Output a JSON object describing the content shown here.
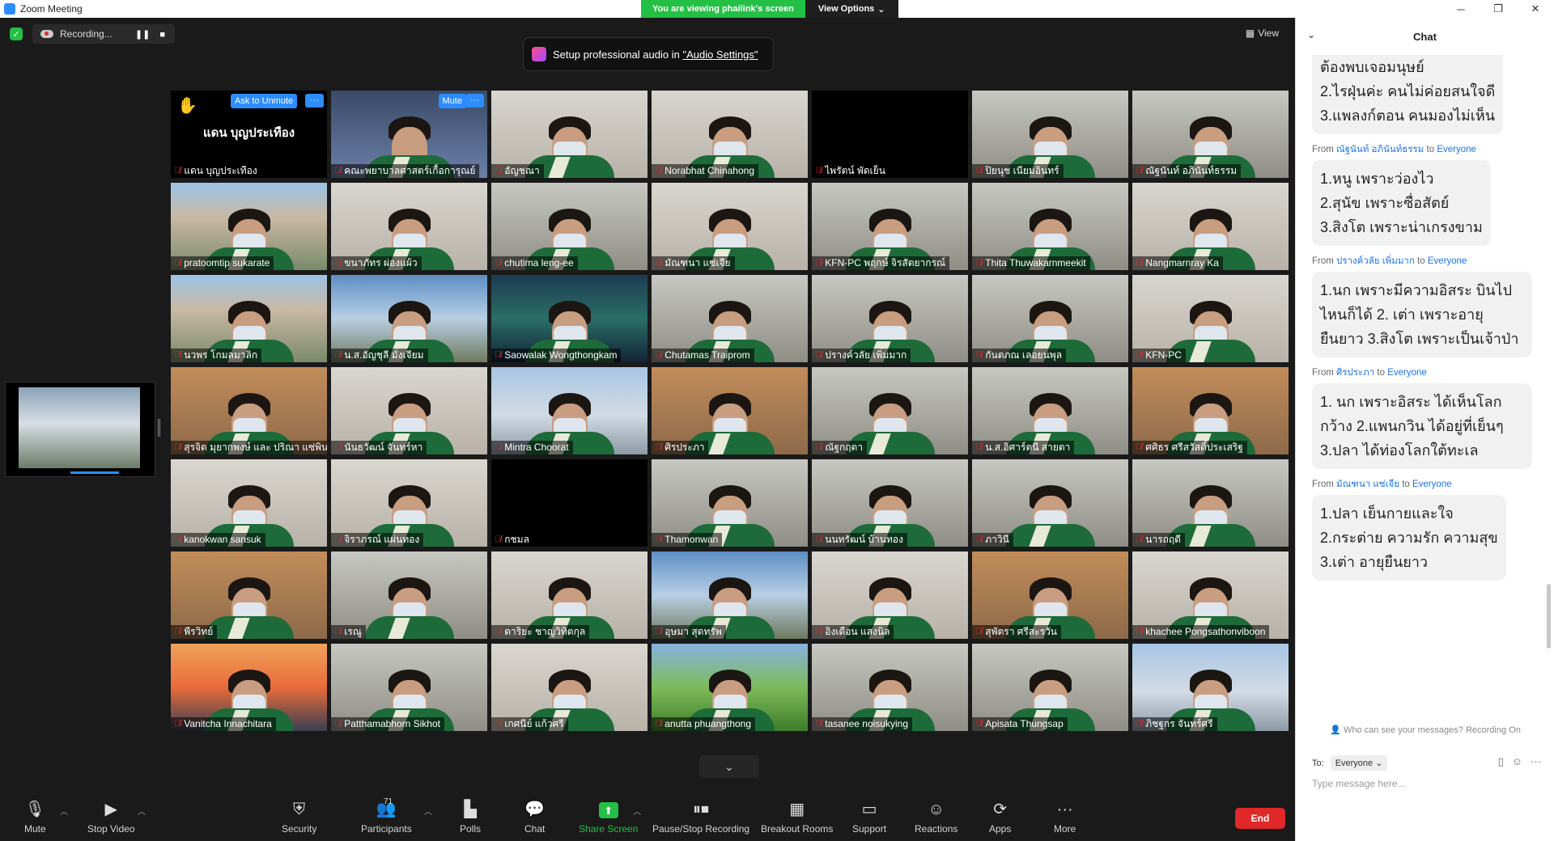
{
  "window": {
    "title": "Zoom Meeting",
    "controls": [
      "─",
      "❐",
      "✕"
    ]
  },
  "banner": {
    "viewing": "You are viewing phailink's screen",
    "view_options": "View Options"
  },
  "recording": {
    "label": "Recording...",
    "pause": "❚❚",
    "stop": "■"
  },
  "view_button": "View",
  "audio_tip": {
    "prefix": "Setup professional audio in ",
    "link": "\"Audio Settings\""
  },
  "first_tile": {
    "display_name": "แดน บุญประเทือง",
    "ask_to_unmute": "Ask to Unmute",
    "more": "···"
  },
  "second_tile": {
    "mute": "Mute",
    "more": "···"
  },
  "tiles": [
    {
      "name": "แดน บุญประเทือง",
      "scene": "black"
    },
    {
      "name": "คณะพยาบาลศาสตร์เกื้อการุณย์",
      "scene": "presenter"
    },
    {
      "name": "อัญชณา",
      "scene": "indoor"
    },
    {
      "name": "Norabhat Chinahong",
      "scene": "indoor"
    },
    {
      "name": "ไพรัตน์ พัดเย็น",
      "scene": "black"
    },
    {
      "name": "ปิยนุช เนียมอินทร์",
      "scene": "office"
    },
    {
      "name": "ณัฐนันท์ อภินันท์ธรรม",
      "scene": "office"
    },
    {
      "name": "pratoomtip sukarate",
      "scene": "building"
    },
    {
      "name": "ขนาภัทร ผ่องแผ้ว",
      "scene": "indoor"
    },
    {
      "name": "chutima leng-ee",
      "scene": "office"
    },
    {
      "name": "มัณฑนา แซ่เจีย",
      "scene": "indoor"
    },
    {
      "name": "KFN-PC พฤกษ์ จิรสัตยากรณ์",
      "scene": "office"
    },
    {
      "name": "Thita Thuwakarnmeekit",
      "scene": "office"
    },
    {
      "name": "Nangmarnray Ka",
      "scene": "indoor"
    },
    {
      "name": "นวพร โกมลมาลิก",
      "scene": "building"
    },
    {
      "name": "น.ส.อัญชุลี มั่งเจียม",
      "scene": "sky"
    },
    {
      "name": "Saowalak Wongthongkam",
      "scene": "aurora"
    },
    {
      "name": "Chutamas Traiprom",
      "scene": "office"
    },
    {
      "name": "ปรางค์วลัย เพิ่มมาก",
      "scene": "office"
    },
    {
      "name": "กันตภณ เลอยนพุล",
      "scene": "office"
    },
    {
      "name": "KFN-PC",
      "scene": "indoor"
    },
    {
      "name": "สุรจิต มุยากพงษ์ และ ปริณา แซ่พิน",
      "scene": "room"
    },
    {
      "name": "นันธวัฒน์ จันทร์หา",
      "scene": "indoor"
    },
    {
      "name": "Mintra Choorat",
      "scene": "city"
    },
    {
      "name": "ศิรประภา",
      "scene": "room"
    },
    {
      "name": "ณัฐกฤตา",
      "scene": "office"
    },
    {
      "name": "น.ส.อิศาร์ตนี สายตา",
      "scene": "office"
    },
    {
      "name": "ศศิธร ศรีสวัสดิ์ประเสริฐ",
      "scene": "room"
    },
    {
      "name": "kanokwan sansuk",
      "scene": "indoor"
    },
    {
      "name": "จิราภรณ์ แผ่นทอง",
      "scene": "indoor"
    },
    {
      "name": "กชมล",
      "scene": "black"
    },
    {
      "name": "Thamonwan",
      "scene": "office"
    },
    {
      "name": "นนทรัฒน์ บ้านทอง",
      "scene": "office"
    },
    {
      "name": "ภาวินี",
      "scene": "office"
    },
    {
      "name": "นารถฤดี",
      "scene": "office"
    },
    {
      "name": "พีรวิทย์",
      "scene": "room"
    },
    {
      "name": "เรณู",
      "scene": "office"
    },
    {
      "name": "ดาริยะ ชาญวิทิตกุล",
      "scene": "indoor"
    },
    {
      "name": "อุษมา สุดทรัพ",
      "scene": "sky"
    },
    {
      "name": "อิงเดือน แสงนิล",
      "scene": "indoor"
    },
    {
      "name": "สุพัตรา ศรีสะรวัน",
      "scene": "room"
    },
    {
      "name": "khachee Pongsathonviboon",
      "scene": "indoor"
    },
    {
      "name": "Vanitcha Innachitara",
      "scene": "bridge"
    },
    {
      "name": "Patthamabhorn Sikhot",
      "scene": "office"
    },
    {
      "name": "เกศนีย์ แก้วศรี",
      "scene": "indoor"
    },
    {
      "name": "anutta phuangthong",
      "scene": "grass"
    },
    {
      "name": "tasanee noisukying",
      "scene": "office"
    },
    {
      "name": "Apisata Thungsap",
      "scene": "office"
    },
    {
      "name": "ภิชฐกร จันทร์ศรี",
      "scene": "city"
    }
  ],
  "toolbar": {
    "mute": "Mute",
    "stop_video": "Stop Video",
    "security": "Security",
    "participants": "Participants",
    "participants_count": "71",
    "polls": "Polls",
    "chat": "Chat",
    "share_screen": "Share Screen",
    "pause_recording": "Pause/Stop Recording",
    "breakout": "Breakout Rooms",
    "support": "Support",
    "reactions": "Reactions",
    "apps": "Apps",
    "more": "More",
    "end": "End"
  },
  "chat": {
    "title": "Chat",
    "messages": [
      {
        "from": "",
        "to": "",
        "text": "ต้องพบเจอมนุษย์\n2.ไรฝุ่นค่ะ คนไม่ค่อยสนใจดี\n3.แพลงก์ตอน คนมองไม่เห็น"
      },
      {
        "from": "ณัฐนันท์ อภินันท์ธรรม",
        "to": "Everyone",
        "text": "1.หนู เพราะว่องไว\n2.สุนัข เพราะซื่อสัตย์\n3.สิงโต เพราะน่าเกรงขาม"
      },
      {
        "from": "ปรางค์วลัย เพิ่มมาก",
        "to": "Everyone",
        "text": "1.นก เพราะมีความอิสระ บินไปไหนก็ได้ 2. เต่า เพราะอายุยืนยาว 3.สิงโต เพราะเป็นเจ้าป่า"
      },
      {
        "from": "ศิรประภา",
        "to": "Everyone",
        "text": "1. นก เพราะอิสระ ได้เห็นโลกกว้าง 2.แพนกวิน ได้อยู่ที่เย็นๆ 3.ปลา ได้ท่องโลกใต้ทะเล"
      },
      {
        "from": "มัณฑนา แซ่เจีย",
        "to": "Everyone",
        "text": "1.ปลา เย็นกายและใจ\n2.กระต่าย ความรัก ความสุข\n3.เต่า อายุยืนยาว"
      }
    ],
    "from_label": "From",
    "to_label": "to",
    "info": "Who can see your messages? Recording On",
    "to": "To:",
    "to_value": "Everyone",
    "placeholder": "Type message here..."
  },
  "colors": {
    "accent": "#2d8cff",
    "green": "#23c045",
    "end": "#e02828"
  }
}
